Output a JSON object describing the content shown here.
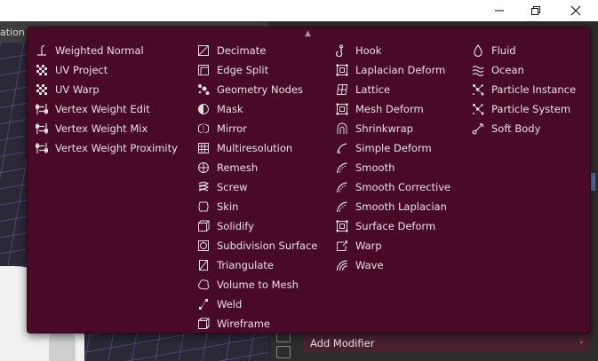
{
  "window": {
    "left_tab_fragment": "ation"
  },
  "menu": {
    "columns": [
      [
        {
          "label": "Weighted Normal",
          "icon": "weighted-normal-icon"
        },
        {
          "label": "UV Project",
          "icon": "checker-icon"
        },
        {
          "label": "UV Warp",
          "icon": "checker-icon"
        },
        {
          "label": "Vertex Weight Edit",
          "icon": "vertex-weight-icon"
        },
        {
          "label": "Vertex Weight Mix",
          "icon": "vertex-weight-icon"
        },
        {
          "label": "Vertex Weight Proximity",
          "icon": "vertex-weight-icon"
        }
      ],
      [
        {
          "label": "Decimate",
          "icon": "decimate-icon"
        },
        {
          "label": "Edge Split",
          "icon": "edge-split-icon"
        },
        {
          "label": "Geometry Nodes",
          "icon": "geometry-nodes-icon"
        },
        {
          "label": "Mask",
          "icon": "mask-icon"
        },
        {
          "label": "Mirror",
          "icon": "mirror-icon"
        },
        {
          "label": "Multiresolution",
          "icon": "multires-icon"
        },
        {
          "label": "Remesh",
          "icon": "remesh-icon"
        },
        {
          "label": "Screw",
          "icon": "screw-icon"
        },
        {
          "label": "Skin",
          "icon": "skin-icon"
        },
        {
          "label": "Solidify",
          "icon": "solidify-icon"
        },
        {
          "label": "Subdivision Surface",
          "icon": "subsurf-icon"
        },
        {
          "label": "Triangulate",
          "icon": "triangulate-icon"
        },
        {
          "label": "Volume to Mesh",
          "icon": "volume-icon"
        },
        {
          "label": "Weld",
          "icon": "weld-icon"
        },
        {
          "label": "Wireframe",
          "icon": "wireframe-icon"
        }
      ],
      [
        {
          "label": "Hook",
          "icon": "hook-icon"
        },
        {
          "label": "Laplacian Deform",
          "icon": "square-dots-icon"
        },
        {
          "label": "Lattice",
          "icon": "lattice-icon"
        },
        {
          "label": "Mesh Deform",
          "icon": "square-dots-icon"
        },
        {
          "label": "Shrinkwrap",
          "icon": "shrinkwrap-icon"
        },
        {
          "label": "Simple Deform",
          "icon": "simple-deform-icon"
        },
        {
          "label": "Smooth",
          "icon": "smooth-icon"
        },
        {
          "label": "Smooth Corrective",
          "icon": "smooth-icon"
        },
        {
          "label": "Smooth Laplacian",
          "icon": "smooth-icon"
        },
        {
          "label": "Surface Deform",
          "icon": "square-dots-icon"
        },
        {
          "label": "Warp",
          "icon": "warp-icon"
        },
        {
          "label": "Wave",
          "icon": "wave-icon"
        }
      ],
      [
        {
          "label": "Fluid",
          "icon": "fluid-icon"
        },
        {
          "label": "Ocean",
          "icon": "ocean-icon"
        },
        {
          "label": "Particle Instance",
          "icon": "particles-icon"
        },
        {
          "label": "Particle System",
          "icon": "particles-icon"
        },
        {
          "label": "Soft Body",
          "icon": "soft-body-icon"
        }
      ]
    ]
  },
  "add_modifier": {
    "label": "Add Modifier"
  },
  "colors": {
    "menu_bg": "#490a28",
    "button_bg": "#4a2130",
    "accent": "#4772b3"
  }
}
